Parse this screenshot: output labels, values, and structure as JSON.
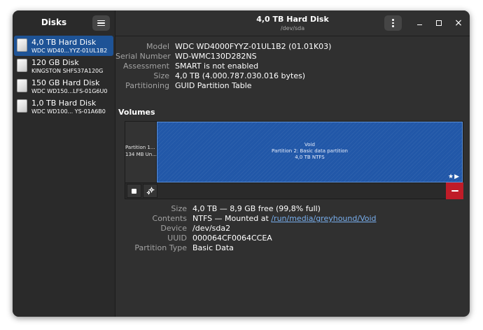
{
  "sidebar": {
    "title": "Disks",
    "disks": [
      {
        "name": "4,0 TB Hard Disk",
        "model": "WDC WD40...YYZ-01UL1B2",
        "selected": true
      },
      {
        "name": "120 GB Disk",
        "model": "KINGSTON SHFS37A120G",
        "selected": false
      },
      {
        "name": "150 GB Hard Disk",
        "model": "WDC WD150...LFS-01G6U0",
        "selected": false
      },
      {
        "name": "1,0 TB Hard Disk",
        "model": "WDC WD100...   YS-01A6B0",
        "selected": false
      }
    ]
  },
  "header": {
    "title": "4,0 TB Hard Disk",
    "subtitle": "/dev/sda",
    "close_glyph": "×"
  },
  "drive": {
    "model_label": "Model",
    "model": "WDC WD4000FYYZ-01UL1B2 (01.01K03)",
    "serial_label": "Serial Number",
    "serial": "WD-WMC130D282NS",
    "assessment_label": "Assessment",
    "assessment": "SMART is not enabled",
    "size_label": "Size",
    "size": "4,0 TB (4.000.787.030.016 bytes)",
    "partitioning_label": "Partitioning",
    "partitioning": "GUID Partition Table"
  },
  "volumes": {
    "heading": "Volumes",
    "segments": [
      {
        "line1": "Partition 1...",
        "line2": "134 MB Un..."
      },
      {
        "line1": "Void",
        "line2": "Partition 2: Basic data partition",
        "line3": "4,0 TB NTFS",
        "flags": "★▶"
      }
    ]
  },
  "partition": {
    "size_label": "Size",
    "size": "4,0 TB — 8,9 GB free (99,8% full)",
    "contents_label": "Contents",
    "contents_prefix": "NTFS — Mounted at ",
    "mount_link": "/run/media/greyhound/Void",
    "device_label": "Device",
    "device": "/dev/sda2",
    "uuid_label": "UUID",
    "uuid": "000064CF0064CCEA",
    "type_label": "Partition Type",
    "type": "Basic Data"
  },
  "colors": {
    "accent": "#1e5396",
    "partition_fill": "#2157a8",
    "destructive": "#c01c28",
    "link": "#78aeed"
  }
}
